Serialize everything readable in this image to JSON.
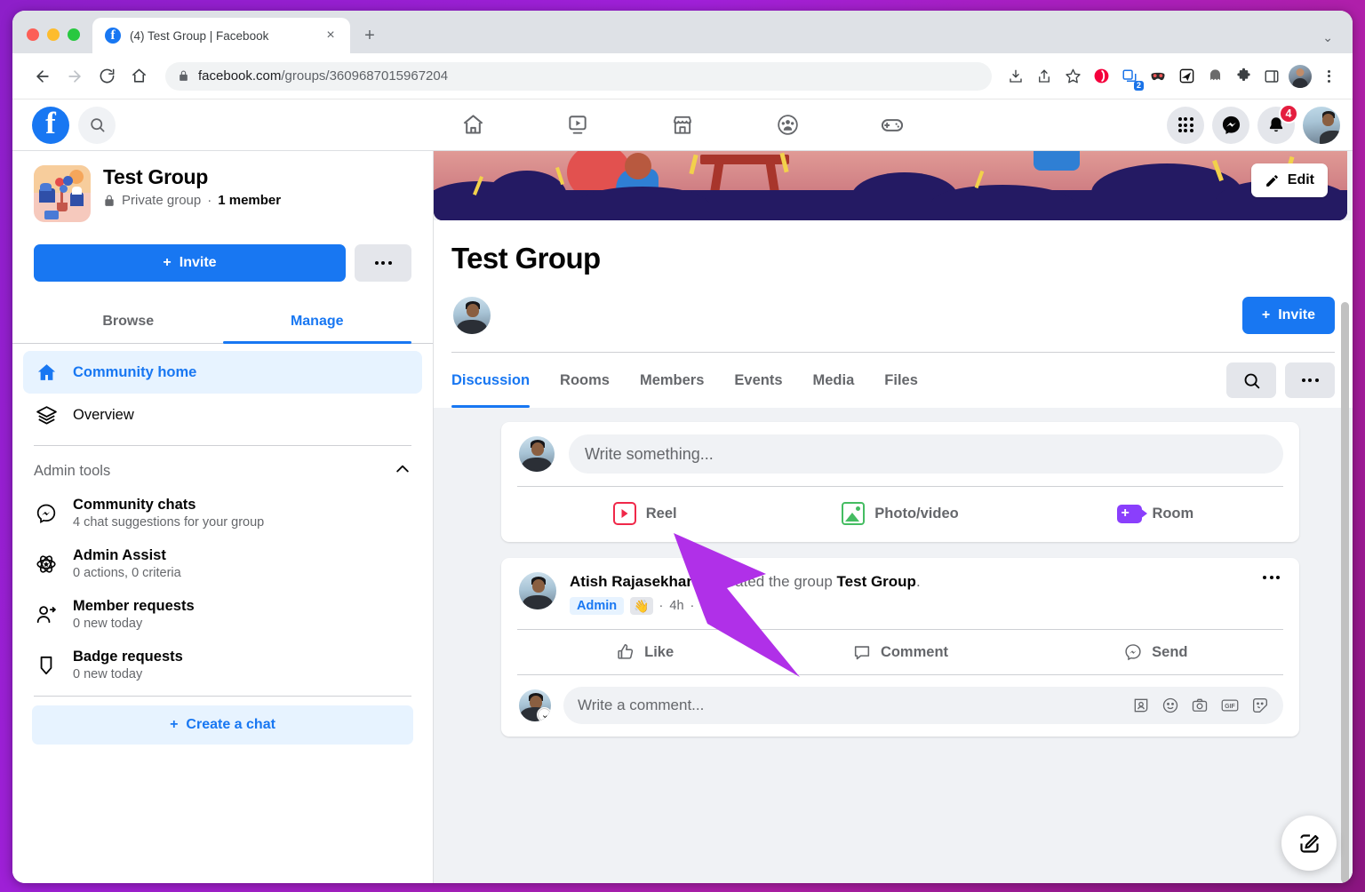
{
  "browser": {
    "tab": {
      "title": "(4) Test Group | Facebook",
      "favicon": "facebook-icon",
      "close": "×"
    },
    "new_tab": "+",
    "window_chevron": "⌄",
    "url_prefix": "facebook.com",
    "url_path": "/groups/3609687015967204",
    "lock_icon": "lock-icon",
    "toolbar_icons": [
      "download-icon",
      "share-icon",
      "bookmark-star-icon",
      "opera-vpn-icon",
      "tab-manager-icon",
      "mask-extension-icon",
      "send-extension-icon",
      "ghostery-icon",
      "puzzle-extensions-icon",
      "side-panel-icon",
      "profile-avatar-icon",
      "chrome-menu-icon"
    ],
    "tab_manager_count": "2"
  },
  "fbnav": {
    "logo": "facebook-logo",
    "search_icon": "search-icon",
    "center_items": [
      "home-icon",
      "video-icon",
      "marketplace-icon",
      "groups-icon",
      "gaming-icon"
    ],
    "menu_icon": "grid-menu-icon",
    "messenger_icon": "messenger-icon",
    "notifications_icon": "bell-icon",
    "notifications_count": "4",
    "account_icon": "account-avatar"
  },
  "sidebar": {
    "group": {
      "name": "Test Group",
      "privacy": "Private group",
      "separator": "·",
      "members": "1 member",
      "lock_icon": "lock-icon",
      "thumbnail": "group-cover-thumbnail"
    },
    "invite_button": "Invite",
    "invite_plus": "+",
    "more_button": "more-options-icon",
    "tabs": [
      {
        "label": "Browse",
        "active": false
      },
      {
        "label": "Manage",
        "active": true
      }
    ],
    "nav": [
      {
        "label": "Community home",
        "icon": "home-icon",
        "active": true
      },
      {
        "label": "Overview",
        "icon": "layers-icon",
        "active": false
      }
    ],
    "admin_section": {
      "title": "Admin tools",
      "collapse_icon": "chevron-up-icon",
      "items": [
        {
          "label": "Community chats",
          "sub": "4 chat suggestions for your group",
          "icon": "messenger-icon"
        },
        {
          "label": "Admin Assist",
          "sub": "0 actions, 0 criteria",
          "icon": "atom-icon"
        },
        {
          "label": "Member requests",
          "sub": "0 new today",
          "icon": "person-add-icon"
        },
        {
          "label": "Badge requests",
          "sub": "0 new today",
          "icon": "badge-shield-icon"
        }
      ]
    },
    "create_chat": "Create a chat",
    "create_chat_plus": "+"
  },
  "main": {
    "cover_alt": "group-cover-photo",
    "edit_button": "Edit",
    "edit_icon": "pencil-icon",
    "title": "Test Group",
    "invite_button": "Invite",
    "invite_plus": "+",
    "tabs": [
      {
        "label": "Discussion",
        "active": true
      },
      {
        "label": "Rooms",
        "active": false
      },
      {
        "label": "Members",
        "active": false
      },
      {
        "label": "Events",
        "active": false
      },
      {
        "label": "Media",
        "active": false
      },
      {
        "label": "Files",
        "active": false
      }
    ],
    "tab_search_icon": "search-icon",
    "tab_more_icon": "more-options-icon",
    "composer": {
      "placeholder": "Write something...",
      "actions": [
        {
          "label": "Reel",
          "icon": "reel-icon"
        },
        {
          "label": "Photo/video",
          "icon": "photo-video-icon"
        },
        {
          "label": "Room",
          "icon": "room-video-icon"
        }
      ]
    },
    "post": {
      "author": "Atish Rajasekharan",
      "action_text": "created the group",
      "group_name": "Test Group",
      "period": ".",
      "badge": "Admin",
      "wave_icon": "wave-hand-icon",
      "dot1": "·",
      "time": "4h",
      "dot2": "·",
      "audience_icon": "public-globe-icon",
      "more_icon": "more-options-icon",
      "actions": [
        {
          "label": "Like",
          "icon": "thumbs-up-icon"
        },
        {
          "label": "Comment",
          "icon": "comment-bubble-icon"
        },
        {
          "label": "Send",
          "icon": "messenger-send-icon"
        }
      ],
      "comment_placeholder": "Write a comment...",
      "comment_icons": [
        "avatar-sticker-icon",
        "emoji-icon",
        "camera-icon",
        "gif-icon",
        "sticker-icon"
      ]
    },
    "fab_icon": "compose-pencil-icon"
  },
  "annotation": {
    "arrow_color": "#b030e8",
    "frame_color": "#a020d8"
  }
}
